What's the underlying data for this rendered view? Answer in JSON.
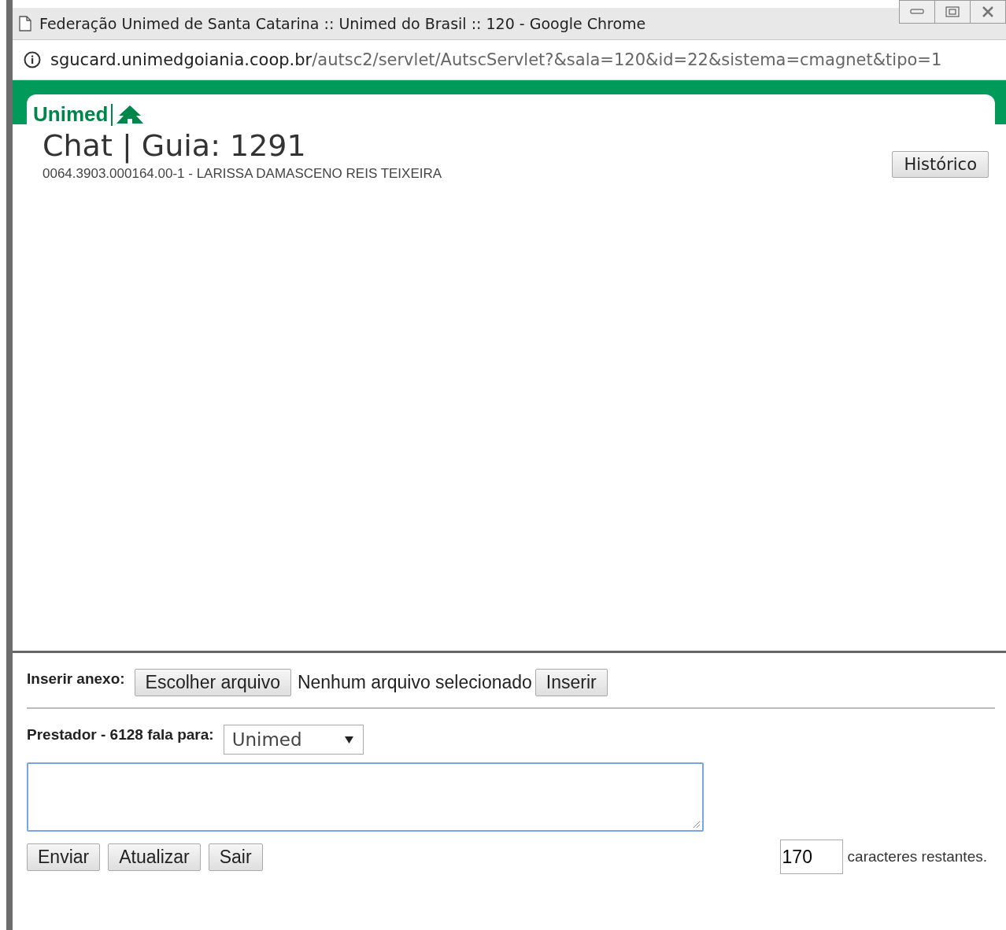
{
  "window": {
    "title": "Federação Unimed de Santa Catarina :: Unimed do Brasil :: 120 - Google Chrome"
  },
  "address_bar": {
    "host": "sgucard.unimedgoiania.coop.br",
    "path": "/autsc2/servlet/AutscServlet?&sala=120&id=22&sistema=cmagnet&tipo=1"
  },
  "header": {
    "logo": "Unimed",
    "title": "Chat | Guia: 1291",
    "subtitle": "0064.3903.000164.00-1 - LARISSA DAMASCENO REIS TEIXEIRA",
    "history_button": "Histórico"
  },
  "attachment": {
    "label": "Inserir anexo:",
    "choose_button": "Escolher arquivo",
    "file_status": "Nenhum arquivo selecionado",
    "insert_button": "Inserir"
  },
  "message": {
    "label": "Prestador - 6128 fala para:",
    "recipient": "Unimed",
    "remaining": "170",
    "remaining_label": "caracteres restantes."
  },
  "buttons": [
    "Enviar",
    "Atualizar",
    "Sair"
  ]
}
